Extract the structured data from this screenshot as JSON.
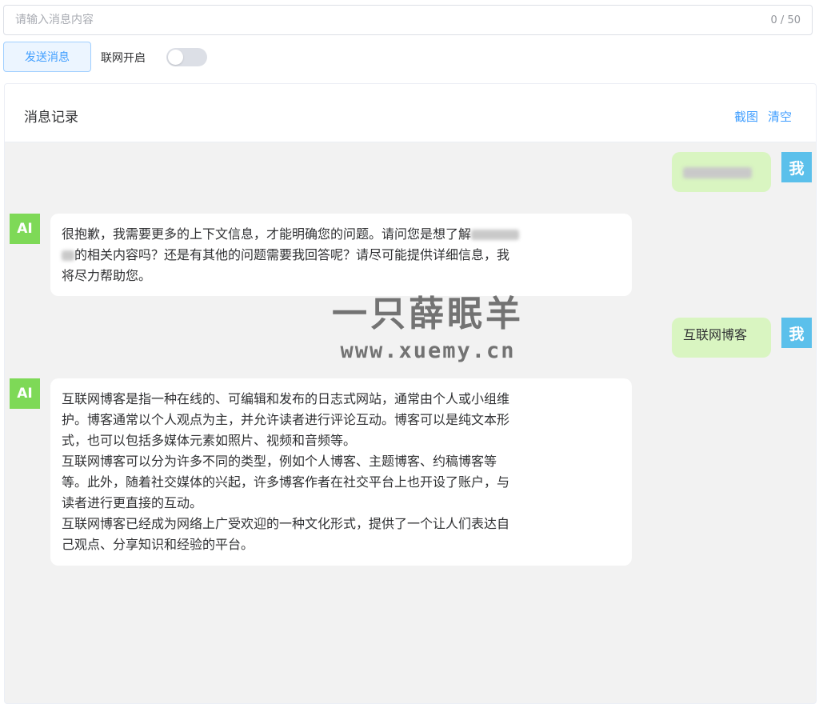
{
  "input": {
    "placeholder": "请输入消息内容",
    "value": "",
    "char_count": "0 / 50"
  },
  "actions": {
    "send_label": "发送消息",
    "toggle_label": "联网开启",
    "toggle_on": false
  },
  "card": {
    "title": "消息记录",
    "screenshot_label": "截图",
    "clear_label": "清空"
  },
  "avatars": {
    "me": "我",
    "ai": "AI"
  },
  "messages": [
    {
      "role": "me",
      "text": ""
    },
    {
      "role": "ai",
      "lines": [
        "很抱歉，我需要更多的上下文信息，才能明确您的问题。请问您是想了解",
        "的相关内容吗？还是有其他的问题需要我回答呢？请尽可能提供详细信息，我",
        "将尽力帮助您。"
      ]
    },
    {
      "role": "me",
      "text": "互联网博客"
    },
    {
      "role": "ai",
      "lines": [
        "互联网博客是指一种在线的、可编辑和发布的日志式网站，通常由个人或小组维",
        "护。博客通常以个人观点为主，并允许读者进行评论互动。博客可以是纯文本形",
        "式，也可以包括多媒体元素如照片、视频和音频等。",
        "互联网博客可以分为许多不同的类型，例如个人博客、主题博客、约稿博客等",
        "等。此外，随着社交媒体的兴起，许多博客作者在社交平台上也开设了账户，与",
        "读者进行更直接的互动。",
        "互联网博客已经成为网络上广受欢迎的一种文化形式，提供了一个让人们表达自",
        "己观点、分享知识和经验的平台。"
      ]
    }
  ],
  "watermark": {
    "logo": "一只薛眠羊",
    "url": "www.xuemy.cn"
  },
  "colors": {
    "accent": "#409eff",
    "me_bubble": "#d9f5c1",
    "me_avatar": "#5bc0eb",
    "ai_avatar": "#7ed957",
    "chat_bg": "#f2f2f2"
  }
}
